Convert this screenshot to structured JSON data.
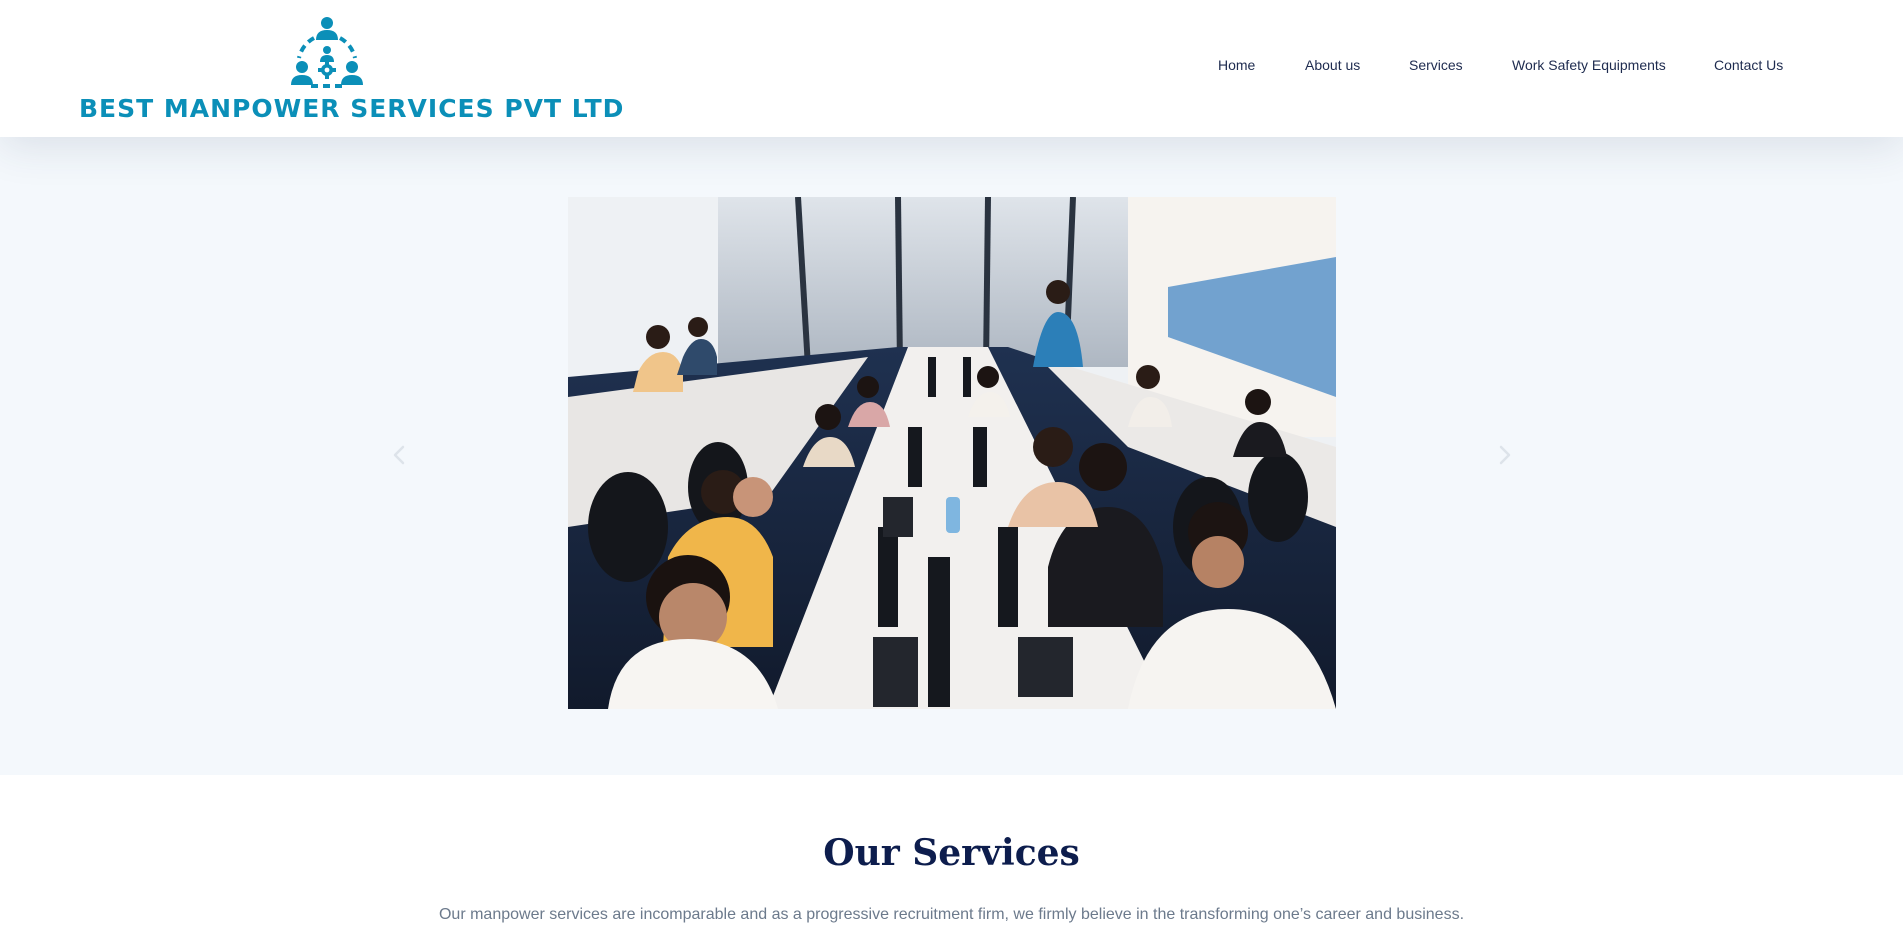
{
  "brand": {
    "name": "BEST MANPOWER SERVICES PVT LTD",
    "color": "#0b8fb8",
    "icon": "people-network-gear-icon"
  },
  "nav": {
    "items": [
      {
        "label": "Home"
      },
      {
        "label": "About us"
      },
      {
        "label": "Services"
      },
      {
        "label": "Work Safety Equipments"
      },
      {
        "label": "Contact Us"
      }
    ]
  },
  "hero": {
    "image": "office-team-photo",
    "prev_icon": "chevron-left-icon",
    "next_icon": "chevron-right-icon",
    "background": "#f4f8fc"
  },
  "services": {
    "heading": "Our Services",
    "description": "Our manpower services are incomparable and as a progressive recruitment firm, we firmly believe in the transforming one’s career and business."
  },
  "colors": {
    "heading": "#0d1d4d",
    "nav_text": "#1e2b4f",
    "body_text": "#6c7a8c"
  }
}
